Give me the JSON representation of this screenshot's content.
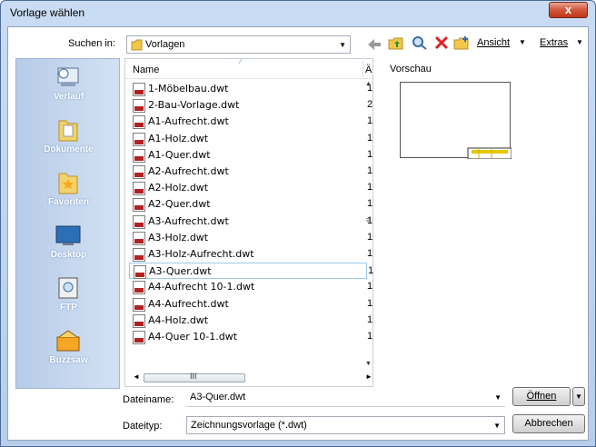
{
  "window": {
    "title": "Vorlage wählen",
    "close_symbol": "x"
  },
  "toolbar": {
    "look_in_label": "Suchen in:",
    "look_in_value": "Vorlagen",
    "view_label": "Ansicht",
    "tools_label": "Extras"
  },
  "places": [
    {
      "label": "Verlauf",
      "icon": "history-icon"
    },
    {
      "label": "Dokumente",
      "icon": "documents-icon"
    },
    {
      "label": "Favoriten",
      "icon": "favorites-icon"
    },
    {
      "label": "Desktop",
      "icon": "desktop-icon"
    },
    {
      "label": "FTP",
      "icon": "ftp-icon"
    },
    {
      "label": "Buzzsaw",
      "icon": "buzzsaw-icon"
    }
  ],
  "filelist": {
    "column_name": "Name",
    "column_truncated": "Ä",
    "files": [
      {
        "name": "1-Möbelbau.dwt",
        "col2": "1"
      },
      {
        "name": "2-Bau-Vorlage.dwt",
        "col2": "2"
      },
      {
        "name": "A1-Aufrecht.dwt",
        "col2": "1"
      },
      {
        "name": "A1-Holz.dwt",
        "col2": "1"
      },
      {
        "name": "A1-Quer.dwt",
        "col2": "1"
      },
      {
        "name": "A2-Aufrecht.dwt",
        "col2": "1"
      },
      {
        "name": "A2-Holz.dwt",
        "col2": "1"
      },
      {
        "name": "A2-Quer.dwt",
        "col2": "1"
      },
      {
        "name": "A3-Aufrecht.dwt",
        "col2": "1"
      },
      {
        "name": "A3-Holz.dwt",
        "col2": "1"
      },
      {
        "name": "A3-Holz-Aufrecht.dwt",
        "col2": "1"
      },
      {
        "name": "A3-Quer.dwt",
        "col2": "1",
        "selected": true
      },
      {
        "name": "A4-Aufrecht 10-1.dwt",
        "col2": "1"
      },
      {
        "name": "A4-Aufrecht.dwt",
        "col2": "1"
      },
      {
        "name": "A4-Holz.dwt",
        "col2": "1"
      },
      {
        "name": "A4-Quer 10-1.dwt",
        "col2": "1"
      }
    ],
    "scroll_grip": "III"
  },
  "preview": {
    "label": "Vorschau"
  },
  "bottom": {
    "filename_label": "Dateiname:",
    "filename_value": "A3-Quer.dwt",
    "filetype_label": "Dateityp:",
    "filetype_value": "Zeichnungsvorlage (*.dwt)",
    "open_label": "Öffnen",
    "cancel_label": "Abbrechen"
  },
  "colors": {
    "title_bg": "#c9dcf2",
    "close_red": "#c23718",
    "places_bg": "#b7cce8",
    "selection_border": "#9ccaf0"
  }
}
